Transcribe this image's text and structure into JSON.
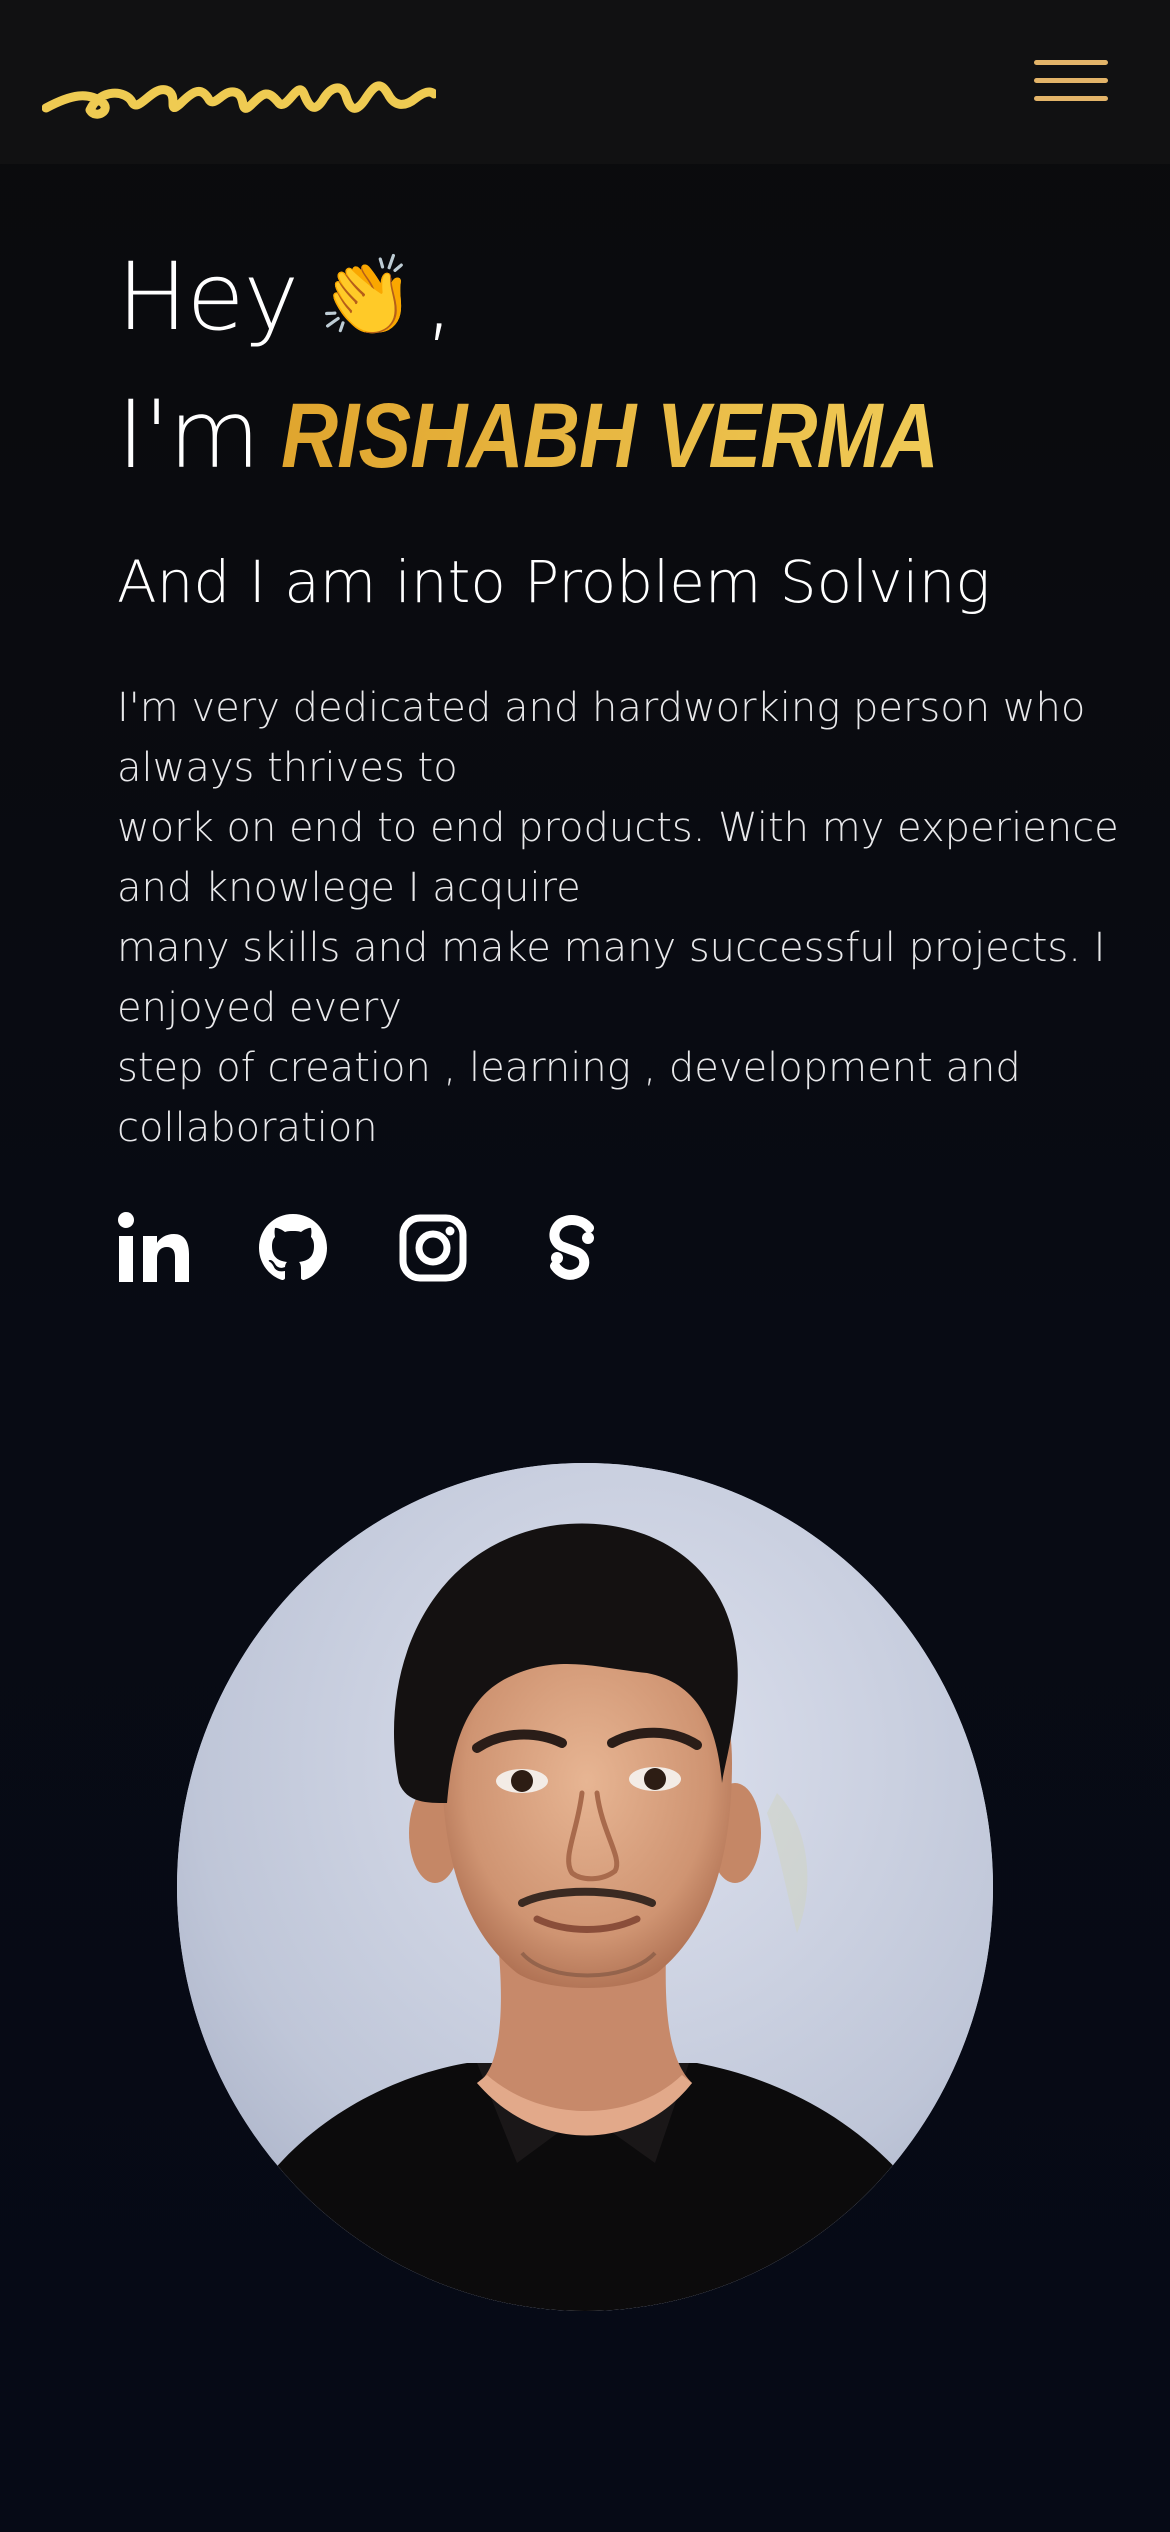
{
  "header": {
    "logo_name": "signature-logo",
    "menu_icon": "hamburger-menu-icon",
    "accent_color": "#e3b469"
  },
  "hero": {
    "greeting": "Hey",
    "wave_emoji": "👏",
    "greeting_suffix": ",",
    "intro_prefix": "I'm",
    "name": "RISHABH VERMA",
    "name_color": "#e9b73c",
    "tagline": "And I am into Problem Solving",
    "bio_lines": [
      "I'm very dedicated and hardworking person who",
      "always thrives to",
      "work on end to end products. With my experience",
      "and knowlege I acquire",
      "many skills and make many successful projects. I",
      "enjoyed every",
      "step of creation , learning , development and",
      "collaboration"
    ]
  },
  "socials": [
    {
      "icon": "linkedin-icon"
    },
    {
      "icon": "github-icon"
    },
    {
      "icon": "instagram-icon"
    },
    {
      "icon": "scrimba-icon"
    }
  ],
  "profile": {
    "image_name": "profile-photo"
  }
}
